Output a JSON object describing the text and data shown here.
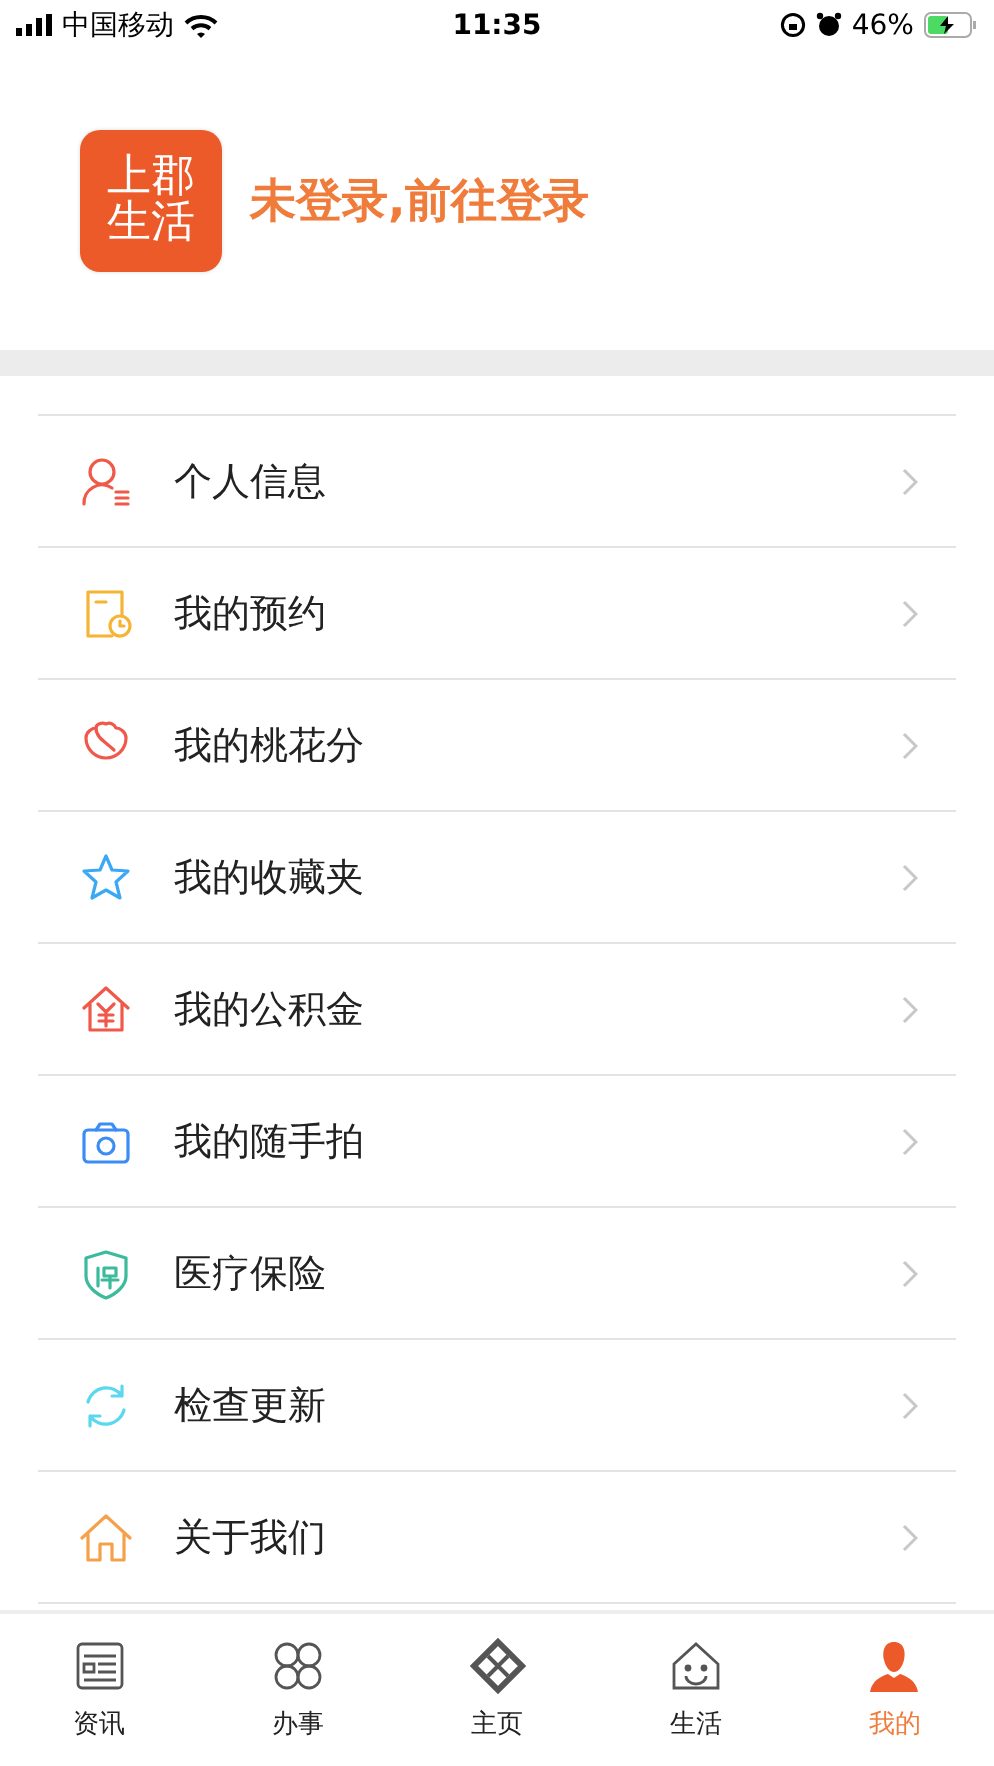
{
  "status_bar": {
    "carrier": "中国移动",
    "time": "11:35",
    "battery": "46%"
  },
  "profile": {
    "logo_lines": [
      "上郡",
      "生活"
    ],
    "login_prompt": "未登录,前往登录"
  },
  "menu": [
    {
      "kind": "person",
      "label": "个人信息"
    },
    {
      "kind": "appointment",
      "label": "我的预约"
    },
    {
      "kind": "peach",
      "label": "我的桃花分"
    },
    {
      "kind": "star",
      "label": "我的收藏夹"
    },
    {
      "kind": "fund",
      "label": "我的公积金"
    },
    {
      "kind": "camera",
      "label": "我的随手拍"
    },
    {
      "kind": "insurance",
      "label": "医疗保险"
    },
    {
      "kind": "update",
      "label": "检查更新"
    },
    {
      "kind": "home",
      "label": "关于我们"
    }
  ],
  "tab_bar": [
    {
      "kind": "news",
      "label": "资讯",
      "selected": false
    },
    {
      "kind": "services",
      "label": "办事",
      "selected": false
    },
    {
      "kind": "main",
      "label": "主页",
      "selected": false
    },
    {
      "kind": "life",
      "label": "生活",
      "selected": false
    },
    {
      "kind": "me",
      "label": "我的",
      "selected": true
    }
  ]
}
